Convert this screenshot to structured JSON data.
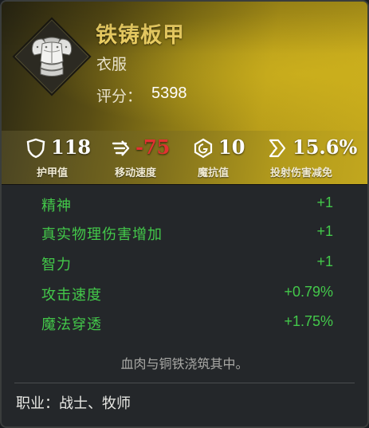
{
  "item": {
    "name": "铁铸板甲",
    "type": "衣服",
    "score_label": "评分：",
    "score_value": "5398",
    "icon": "plate-armor-chestpiece-icon"
  },
  "stats": [
    {
      "icon": "shield-icon",
      "value": "118",
      "label": "护甲值",
      "negative": false
    },
    {
      "icon": "speed-icon",
      "value": "-75",
      "label": "移动速度",
      "negative": true
    },
    {
      "icon": "magic-resist-icon",
      "value": "10",
      "label": "魔抗值",
      "negative": false
    },
    {
      "icon": "projectile-reduction-icon",
      "value": "15.6%",
      "label": "投射伤害减免",
      "negative": false
    }
  ],
  "attributes": [
    {
      "name": "精神",
      "value": "+1"
    },
    {
      "name": "真实物理伤害增加",
      "value": "+1"
    },
    {
      "name": "智力",
      "value": "+1"
    },
    {
      "name": "攻击速度",
      "value": "+0.79%"
    },
    {
      "name": "魔法穿透",
      "value": "+1.75%"
    }
  ],
  "flavor_text": "血肉与铜铁浇筑其中。",
  "class_line": "职业：战士、牧师",
  "colors": {
    "name_gold": "#f3d566",
    "attribute_green": "#43c84a",
    "negative_red": "#e23131",
    "header_gold": "#c4a81c",
    "panel_bg": "#24272a"
  }
}
